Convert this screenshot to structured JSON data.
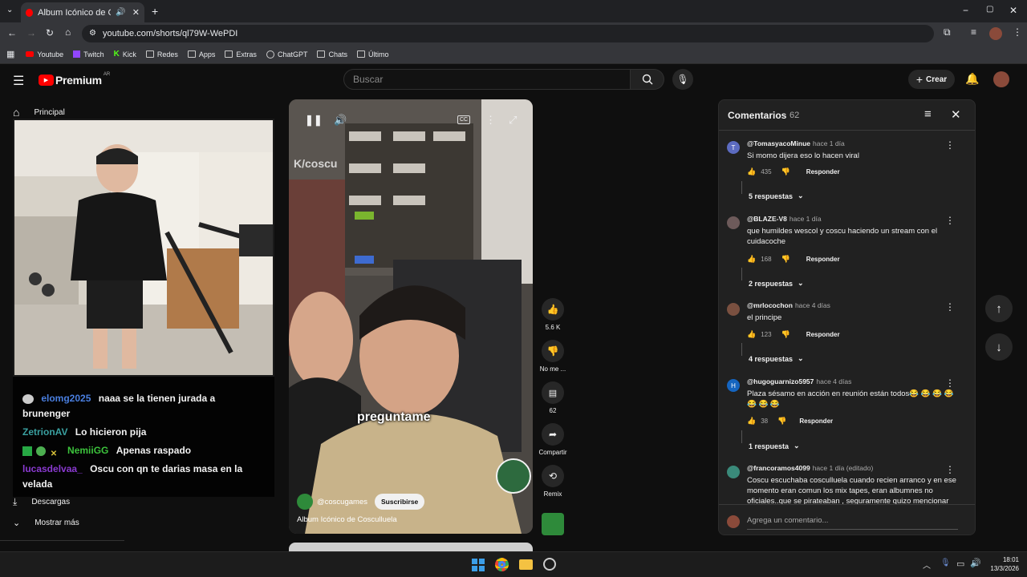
{
  "browser": {
    "tab_title": "Album Icónico de Cosculluela",
    "url": "youtube.com/shorts/ql79W-WePDI",
    "bookmarks": [
      "Youtube",
      "Twitch",
      "Kick",
      "Redes",
      "Apps",
      "Extras",
      "ChatGPT",
      "Chats",
      "Último"
    ]
  },
  "yt": {
    "logo": "Premium",
    "region": "AR",
    "search_placeholder": "Buscar",
    "create_label": "Crear"
  },
  "sidebar": {
    "home": "Principal",
    "downloads": "Descargas",
    "show_more": "Mostrar más"
  },
  "chat": [
    {
      "user": "elomg2025",
      "text": "naaa se la tienen jurada a",
      "cont": "brunenger",
      "color": "#4a7fe0"
    },
    {
      "user": "ZetrionAV",
      "text": "Lo hicieron pija",
      "color": "#3aa0a0"
    },
    {
      "user": "NemiiGG",
      "text": "Apenas raspado",
      "color": "#3cc23c"
    },
    {
      "user": "lucasdelvaa_",
      "text": "Oscu con qn te darias masa en la",
      "cont": "velada",
      "color": "#8a3ad0"
    }
  ],
  "short": {
    "caption": "preguntame",
    "watermark": "K/coscu",
    "channel": "@coscugames",
    "subscribe": "Suscribirse",
    "title": "Album Icónico de Cosculluela",
    "likes": "5.6 K",
    "dislike": "No me ...",
    "comments": "62",
    "share": "Compartir",
    "remix": "Remix"
  },
  "comments_panel": {
    "title": "Comentarios",
    "count": "62",
    "reply_label": "Responder",
    "add_placeholder": "Agrega un comentario...",
    "items": [
      {
        "author": "@TomasyacoMinue",
        "time": "hace 1 día",
        "text": "Si momo dijera eso lo hacen viral",
        "likes": "435",
        "replies": "5 respuestas",
        "avatar_letter": "T",
        "avatar_color": "#5c6bc0"
      },
      {
        "author": "@BLAZE-V8",
        "time": "hace 1 día",
        "text": "que humildes wescol y coscu haciendo un stream con el cuidacoche",
        "likes": "168",
        "replies": "2 respuestas",
        "avatar_letter": "",
        "avatar_color": "#6d5a5a"
      },
      {
        "author": "@mrlocochon",
        "time": "hace 4 días",
        "text": "el principe",
        "likes": "123",
        "replies": "4 respuestas",
        "avatar_letter": "",
        "avatar_color": "#7a5040"
      },
      {
        "author": "@hugoguarnizo5957",
        "time": "hace 4 días",
        "text": "Plaza sésamo en acción en reunión están todos😂 😂 😂 😂 😂 😂 😂",
        "likes": "38",
        "replies": "1 respuesta",
        "avatar_letter": "H",
        "avatar_color": "#1565c0"
      },
      {
        "author": "@francoramos4099",
        "time": "hace 1 día (editado)",
        "text": "Coscu escuchaba cosculluela cuando recien arranco y en ese momento eran comun los mix tapes, eran albumnes no oficiales..que se pirateaban , seguramente quizo mencionar",
        "likes": "",
        "replies": "",
        "avatar_letter": "",
        "avatar_color": "#3a8a7a"
      }
    ]
  },
  "taskbar": {
    "time": "18:01",
    "date": "13/3/2026"
  }
}
